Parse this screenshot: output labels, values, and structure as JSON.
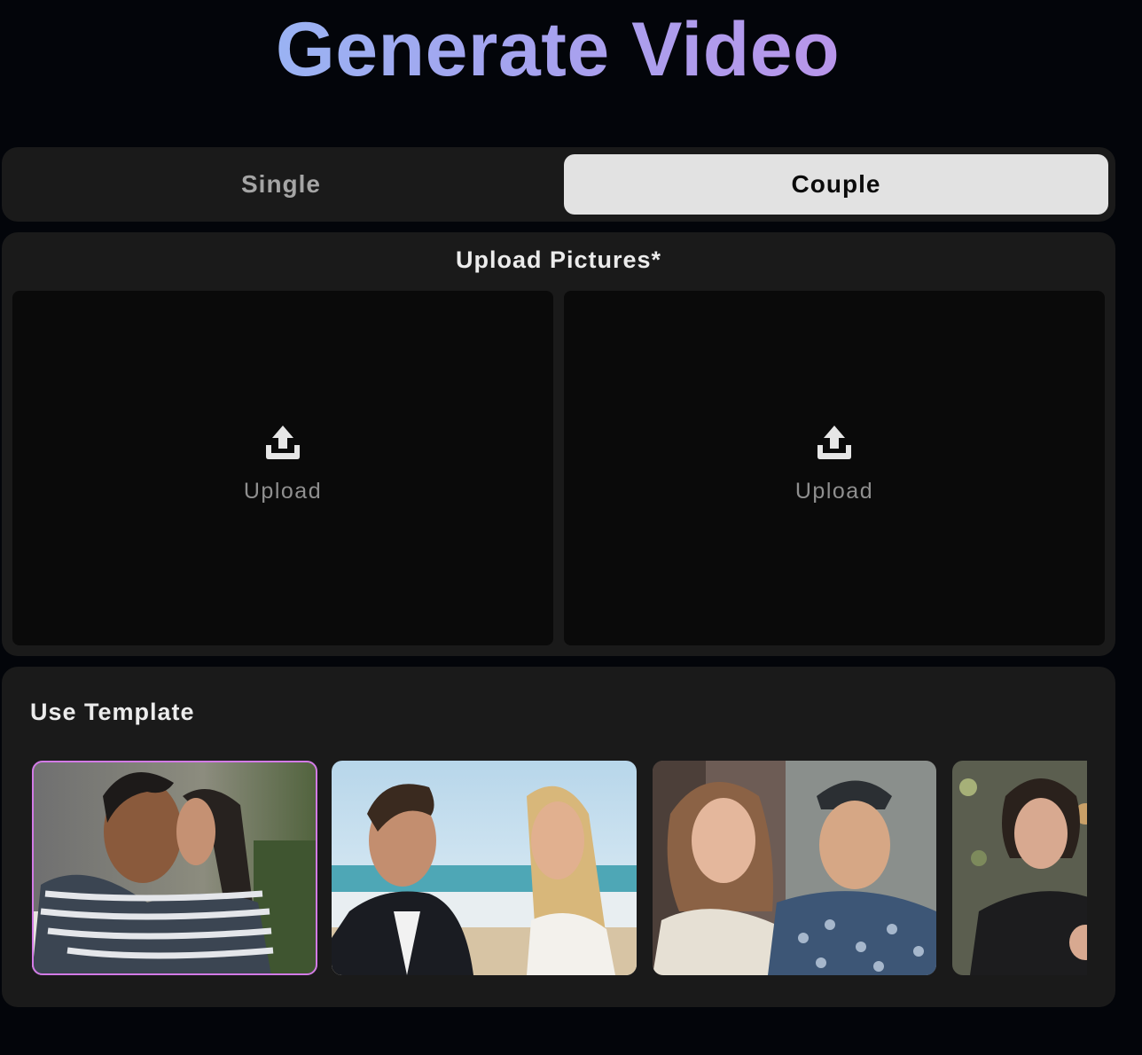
{
  "header": {
    "title": "Generate Video"
  },
  "mode_toggle": {
    "options": [
      {
        "label": "Single",
        "selected": false
      },
      {
        "label": "Couple",
        "selected": true
      }
    ]
  },
  "upload": {
    "title": "Upload Pictures*",
    "slots": [
      {
        "label": "Upload",
        "icon": "upload-icon"
      },
      {
        "label": "Upload",
        "icon": "upload-icon"
      }
    ]
  },
  "templates": {
    "title": "Use Template",
    "selected_index": 0,
    "items": [
      {
        "subject": "couple-embracing"
      },
      {
        "subject": "couple-on-beach"
      },
      {
        "subject": "couple-smiling-outdoors"
      },
      {
        "subject": "woman-portrait"
      }
    ]
  },
  "colors": {
    "background": "#03050a",
    "panel": "#1a1a1a",
    "slot": "#0a0a0a",
    "active_tab": "#e2e2e2",
    "selected_outline": "#d27ae6",
    "title_gradient_start": "#8ec5f8",
    "title_gradient_end": "#c88ae6"
  }
}
